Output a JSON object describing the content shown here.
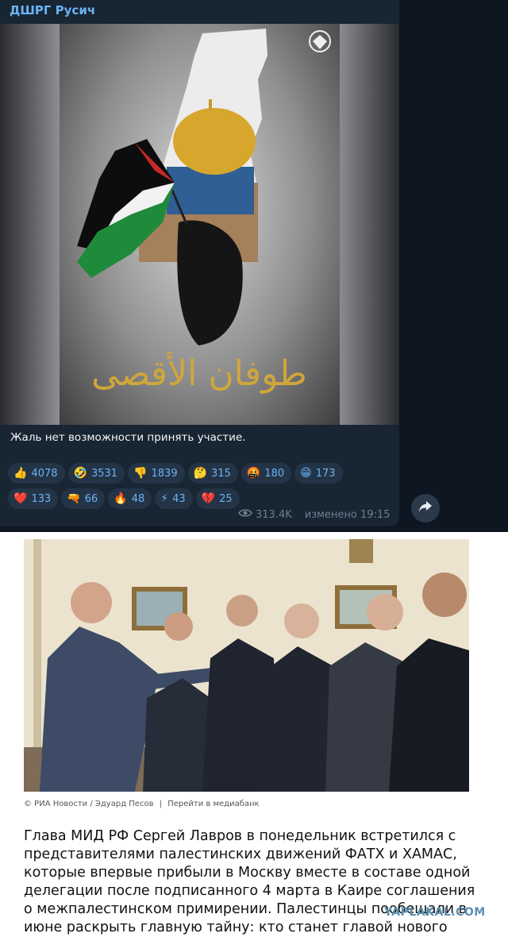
{
  "channel": {
    "name": "ДШРГ Русич"
  },
  "post": {
    "arabic_caption": "طوفان الأقصى",
    "caption": "Жаль нет возможности принять участие.",
    "reactions": [
      {
        "emoji": "👍",
        "icon": "thumbs-up-icon",
        "count": "4078"
      },
      {
        "emoji": "🤣",
        "icon": "rofl-icon",
        "count": "3531"
      },
      {
        "emoji": "👎",
        "icon": "thumbs-down-icon",
        "count": "1839"
      },
      {
        "emoji": "🤔",
        "icon": "thinking-icon",
        "count": "315"
      },
      {
        "emoji": "🤬",
        "icon": "angry-icon",
        "count": "180"
      },
      {
        "emoji": "😁",
        "icon": "grin-icon",
        "count": "173"
      },
      {
        "emoji": "❤️",
        "icon": "heart-icon",
        "count": "133"
      },
      {
        "emoji": "🔫",
        "icon": "pistol-icon",
        "count": "66"
      },
      {
        "emoji": "🔥",
        "icon": "fire-icon",
        "count": "48"
      },
      {
        "emoji": "⚡",
        "icon": "lightning-icon",
        "count": "43"
      },
      {
        "emoji": "💔",
        "icon": "broken-heart-icon",
        "count": "25"
      }
    ],
    "views": "313.4K",
    "edited": "изменено 19:15"
  },
  "credit": {
    "source": "© РИА Новости / Эдуард Песов",
    "sep": "|",
    "link": "Перейти в медиабанк"
  },
  "article": {
    "text": "Глава МИД РФ Сергей Лавров в понедельник встретился с представителями палестинских движений ФАТХ и ХАМАС, которые впервые прибыли в Москву вместе в составе одной делегации после подписанного 4 марта в Каире соглашения о межпалестинском примирении. Палестинцы пообещали в июне раскрыть главную тайну: кто станет главой нового"
  },
  "watermark": "YAPLAKAL.COM"
}
